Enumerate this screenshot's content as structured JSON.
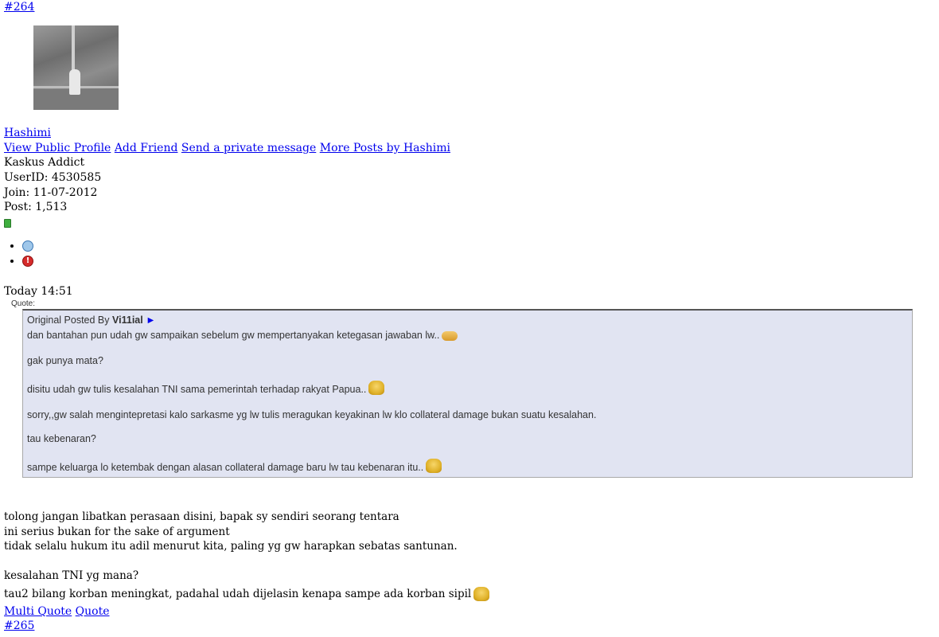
{
  "post_prev_number": "#264",
  "user": {
    "name": "Hashimi",
    "links": [
      "View Public Profile",
      "Add Friend",
      "Send a private message",
      "More Posts by Hashimi"
    ],
    "rank": "Kaskus Addict",
    "userid": "UserID: 4530585",
    "join": "Join: 11-07-2012",
    "post": "Post: 1,513"
  },
  "icons": [
    "user-status-icon",
    "report-icon"
  ],
  "timestamp": "Today 14:51",
  "quote": {
    "label": "Quote:",
    "posted_by_prefix": "Original Posted By",
    "author": "Vi11ial",
    "arrow": "►",
    "lines": [
      "dan bantahan pun udah gw sampaikan sebelum gw mempertanyakan ketegasan jawaban lw..",
      "gak punya mata?",
      "disitu udah gw tulis kesalahan TNI sama pemerintah terhadap rakyat Papua..",
      "sorry,,gw salah mengintepretasi kalo sarkasme yg lw tulis meragukan keyakinan lw klo collateral damage bukan suatu kesalahan.",
      "tau kebenaran?",
      "sampe keluarga lo ketembak dengan alasan collateral damage baru lw tau kebenaran itu.."
    ]
  },
  "body": {
    "lines": [
      "tolong jangan libatkan perasaan disini, bapak sy sendiri seorang tentara",
      "ini serius bukan for the sake of argument",
      "tidak selalu hukum itu adil menurut kita, paling yg gw harapkan sebatas santunan.",
      "kesalahan TNI yg mana?",
      "tau2 bilang korban meningkat, padahal udah dijelasin kenapa sampe ada korban sipil"
    ]
  },
  "actions": {
    "multi_quote": "Multi Quote",
    "quote": "Quote"
  },
  "post_next_number": "#265"
}
